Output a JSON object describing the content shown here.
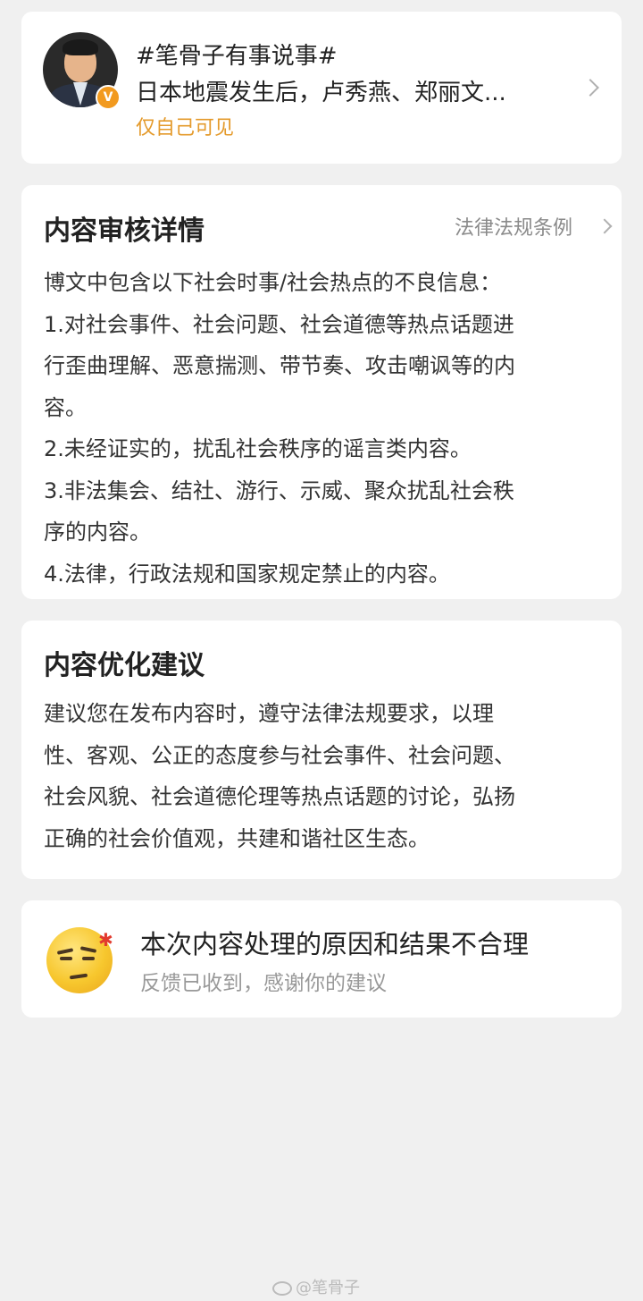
{
  "post": {
    "avatar_badge": "V",
    "topic": "#笔骨子有事说事#",
    "text": "日本地震发生后，卢秀燕、郑丽文...",
    "visibility": "仅自己可见"
  },
  "review": {
    "title": "内容审核详情",
    "law_link": "法律法规条例",
    "lines": [
      "博文中包含以下社会时事/社会热点的不良信息：",
      "1.对社会事件、社会问题、社会道德等热点话题进",
      "行歪曲理解、恶意揣测、带节奏、攻击嘲讽等的内",
      "容。",
      "2.未经证实的，扰乱社会秩序的谣言类内容。",
      "3.非法集会、结社、游行、示威、聚众扰乱社会秩",
      "序的内容。",
      "4.法律，行政法规和国家规定禁止的内容。"
    ]
  },
  "suggestion": {
    "title": "内容优化建议",
    "lines": [
      "建议您在发布内容时，遵守法律法规要求，以理",
      "性、客观、公正的态度参与社会事件、社会问题、",
      "社会风貌、社会道德伦理等热点话题的讨论，弘扬",
      "正确的社会价值观，共建和谐社区生态。"
    ]
  },
  "feedback": {
    "title": "本次内容处理的原因和结果不合理",
    "subtitle": "反馈已收到，感谢你的建议"
  },
  "watermark": "@笔骨子",
  "colors": {
    "background": "#f0f0f0",
    "card": "#ffffff",
    "visibility_orange": "#e49a2b",
    "badge_orange": "#f29a1f",
    "muted_text": "#999999"
  }
}
